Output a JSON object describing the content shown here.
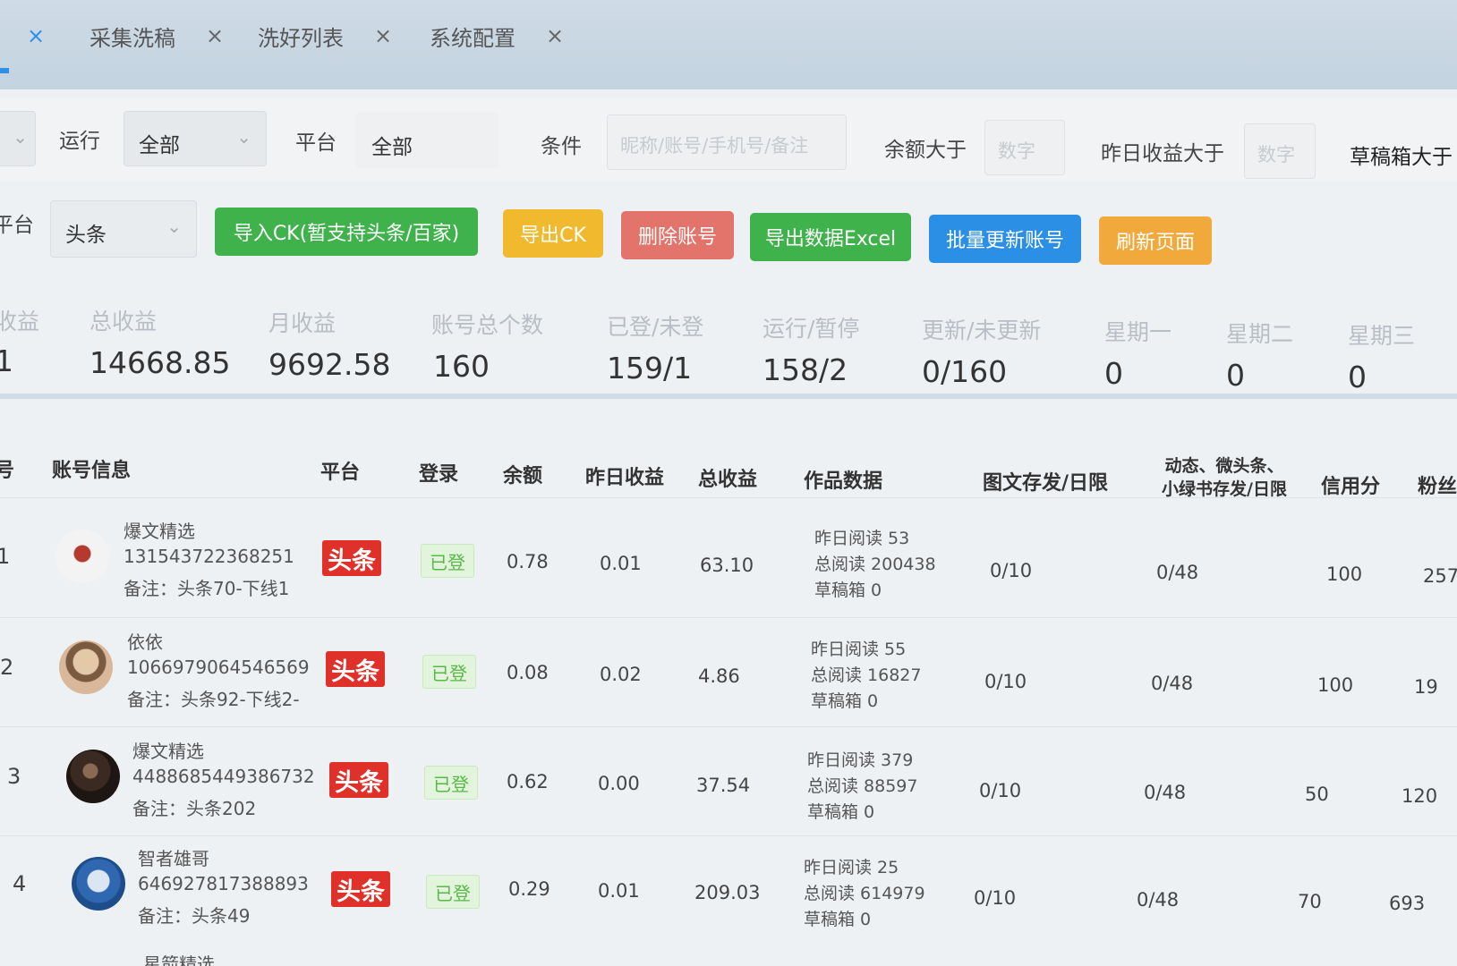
{
  "tabs": [
    {
      "label": "",
      "close": "×"
    },
    {
      "label": "采集洗稿",
      "close": "×"
    },
    {
      "label": "洗好列表",
      "close": "×"
    },
    {
      "label": "系统配置",
      "close": "×"
    }
  ],
  "filters": {
    "run_label": "运行",
    "run_value": "全部",
    "platform_label": "平台",
    "platform_value": "全部",
    "condition_label": "条件",
    "condition_placeholder": "昵称/账号/手机号/备注",
    "balance_label": "余额大于",
    "balance_placeholder": "数字",
    "yesterday_label": "昨日收益大于",
    "yesterday_placeholder": "数字",
    "draft_label": "草稿箱大于",
    "platform2_label": "平台",
    "platform2_value": "头条"
  },
  "buttons": {
    "import_ck": "导入CK(暂支持头条/百家)",
    "export_ck": "导出CK",
    "delete_account": "删除账号",
    "export_excel": "导出数据Excel",
    "batch_update": "批量更新账号",
    "refresh_page": "刷新页面"
  },
  "colors": {
    "green": "#3fb24c",
    "yellow": "#f1b92d",
    "red": "#e2746b",
    "blue": "#2c8fe6",
    "orange": "#f0a93a",
    "toutiao_red": "#e0302a"
  },
  "stats": [
    {
      "label": "收益",
      "value": "1"
    },
    {
      "label": "总收益",
      "value": "14668.85"
    },
    {
      "label": "月收益",
      "value": "9692.58"
    },
    {
      "label": "账号总个数",
      "value": "160"
    },
    {
      "label": "已登/未登",
      "value": "159/1"
    },
    {
      "label": "运行/暂停",
      "value": "158/2"
    },
    {
      "label": "更新/未更新",
      "value": "0/160"
    },
    {
      "label": "星期一",
      "value": "0"
    },
    {
      "label": "星期二",
      "value": "0"
    },
    {
      "label": "星期三",
      "value": "0"
    }
  ],
  "table": {
    "headers": {
      "num": "号",
      "account": "账号信息",
      "platform": "平台",
      "login": "登录",
      "balance": "余额",
      "yesterday": "昨日收益",
      "total": "总收益",
      "works": "作品数据",
      "article": "图文存发/日限",
      "dynamic1": "动态、微头条、",
      "dynamic2": "小绿书存发/日限",
      "credit": "信用分",
      "fans": "粉丝"
    },
    "rows": [
      {
        "num": "1",
        "name": "爆文精选",
        "id": "131543722368251",
        "note": "备注：头条70-下线1",
        "platform": "头条",
        "login": "已登",
        "balance": "0.78",
        "yesterday": "0.01",
        "total": "63.10",
        "yread": "昨日阅读 53",
        "tread": "总阅读 200438",
        "draft": "草稿箱 0",
        "article": "0/10",
        "dynamic": "0/48",
        "credit": "100",
        "fans": "257"
      },
      {
        "num": "2",
        "name": "依依",
        "id": "1066979064546569",
        "note": "备注：头条92-下线2-",
        "platform": "头条",
        "login": "已登",
        "balance": "0.08",
        "yesterday": "0.02",
        "total": "4.86",
        "yread": "昨日阅读 55",
        "tread": "总阅读 16827",
        "draft": "草稿箱 0",
        "article": "0/10",
        "dynamic": "0/48",
        "credit": "100",
        "fans": "19"
      },
      {
        "num": "3",
        "name": "爆文精选",
        "id": "4488685449386732",
        "note": "备注：头条202",
        "platform": "头条",
        "login": "已登",
        "balance": "0.62",
        "yesterday": "0.00",
        "total": "37.54",
        "yread": "昨日阅读 379",
        "tread": "总阅读 88597",
        "draft": "草稿箱 0",
        "article": "0/10",
        "dynamic": "0/48",
        "credit": "50",
        "fans": "120"
      },
      {
        "num": "4",
        "name": "智者雄哥",
        "id": "646927817388893",
        "note": "备注：头条49",
        "platform": "头条",
        "login": "已登",
        "balance": "0.29",
        "yesterday": "0.01",
        "total": "209.03",
        "yread": "昨日阅读 25",
        "tread": "总阅读 614979",
        "draft": "草稿箱 0",
        "article": "0/10",
        "dynamic": "0/48",
        "credit": "70",
        "fans": "693"
      }
    ],
    "partial_row_name": "星箭精选"
  }
}
